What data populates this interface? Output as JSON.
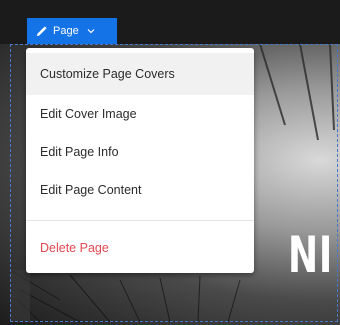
{
  "toolbar": {
    "page_button_label": "Page"
  },
  "menu": {
    "items": [
      {
        "label": "Customize Page Covers"
      },
      {
        "label": "Edit Cover Image"
      },
      {
        "label": "Edit Page Info"
      },
      {
        "label": "Edit Page Content"
      }
    ],
    "danger_item": {
      "label": "Delete Page"
    }
  },
  "cover": {
    "title_fragment": "NI"
  },
  "colors": {
    "accent": "#1473e6",
    "danger": "#e34850"
  },
  "icons": {
    "pencil": "pencil-icon",
    "chevron": "chevron-down-icon"
  }
}
